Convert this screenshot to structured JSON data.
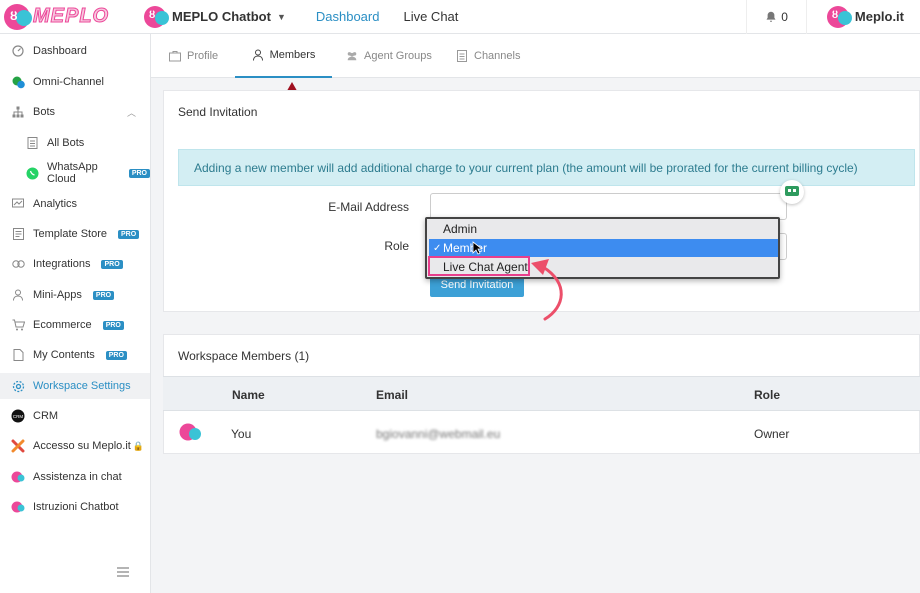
{
  "topbar": {
    "logo_text": "MEPLO",
    "bot_name": "MEPLO Chatbot",
    "nav": [
      "Dashboard",
      "Live Chat"
    ],
    "notifications": "0",
    "account_name": "Meplo.it"
  },
  "sidebar": {
    "items": [
      {
        "label": "Dashboard",
        "icon": "dashboard-icon"
      },
      {
        "label": "Omni-Channel",
        "icon": "chat-bubbles-icon"
      },
      {
        "label": "Bots",
        "icon": "sitemap-icon"
      },
      {
        "label": "All Bots",
        "icon": "document-icon"
      },
      {
        "label": "WhatsApp Cloud",
        "icon": "whatsapp-icon",
        "badge": "PRO"
      },
      {
        "label": "Analytics",
        "icon": "analytics-icon"
      },
      {
        "label": "Template Store",
        "icon": "template-icon",
        "badge": "PRO"
      },
      {
        "label": "Integrations",
        "icon": "integrations-icon",
        "badge": "PRO"
      },
      {
        "label": "Mini-Apps",
        "icon": "user-icon",
        "badge": "PRO"
      },
      {
        "label": "Ecommerce",
        "icon": "cart-icon",
        "badge": "PRO"
      },
      {
        "label": "My Contents",
        "icon": "file-icon",
        "badge": "PRO"
      },
      {
        "label": "Workspace Settings",
        "icon": "gear-icon"
      },
      {
        "label": "CRM",
        "icon": "crm-icon"
      },
      {
        "label": "Accesso su Meplo.it",
        "icon": "meplo-x-icon"
      },
      {
        "label": "Assistenza in chat",
        "icon": "meplo-logo-icon"
      },
      {
        "label": "Istruzioni Chatbot",
        "icon": "meplo-logo-icon"
      }
    ]
  },
  "tabs": [
    "Profile",
    "Members",
    "Agent Groups",
    "Channels"
  ],
  "invitation": {
    "title": "Send Invitation",
    "alert": "Adding a new member will add additional charge to your current plan (the amount will be prorated for the current billing cycle)",
    "email_label": "E-Mail Address",
    "email_value": "",
    "role_label": "Role",
    "role_options": [
      "Admin",
      "Member",
      "Live Chat Agent"
    ],
    "role_selected": "Member",
    "send_label": "Send Invitation"
  },
  "members": {
    "title": "Workspace Members (1)",
    "columns": [
      "Name",
      "Email",
      "Role"
    ],
    "rows": [
      {
        "name": "You",
        "email": "bgiovanni@webmail.eu",
        "role": "Owner"
      }
    ]
  },
  "colors": {
    "accent": "#2b8fc4",
    "brand_pink": "#ec4899",
    "brand_cyan": "#3ac3d6",
    "alert_bg": "#d3eef3",
    "annotation_red": "#a01020",
    "highlight_pink": "#e83e8c"
  }
}
